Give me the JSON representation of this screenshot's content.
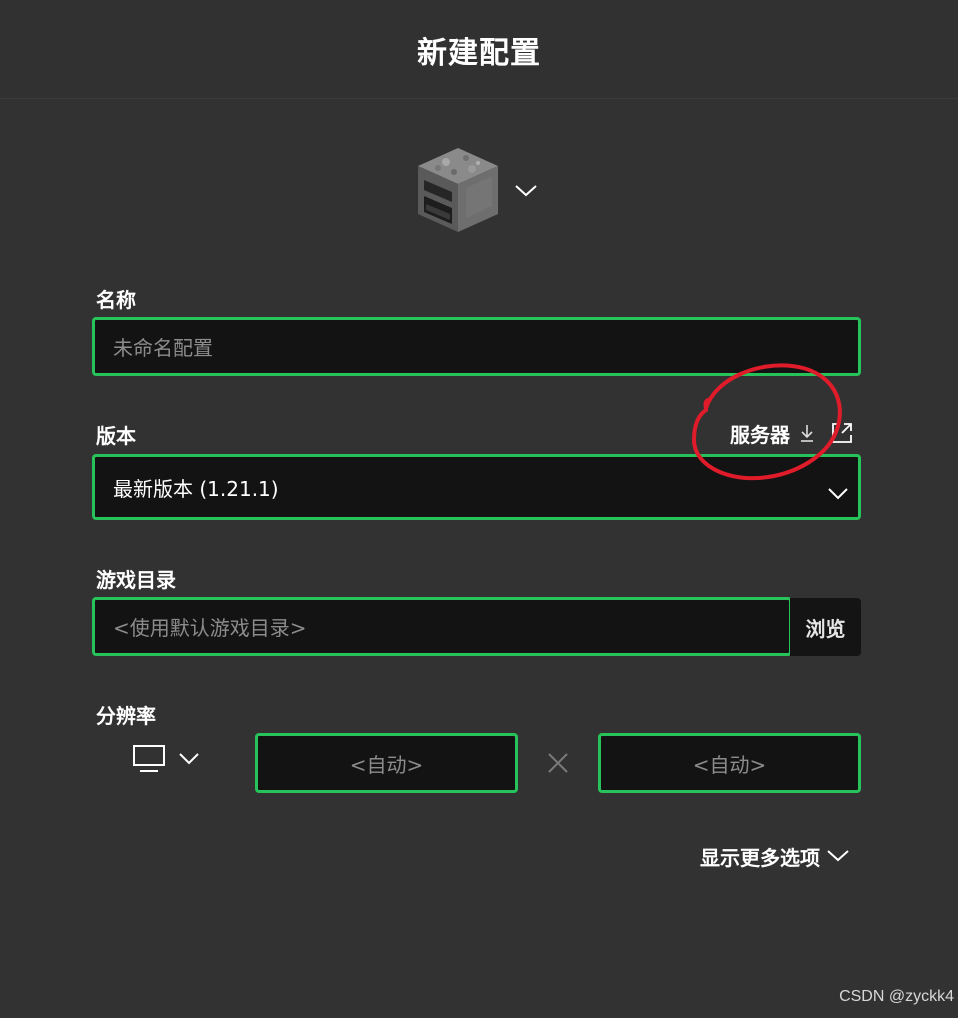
{
  "header": {
    "title": "新建配置"
  },
  "icon_picker": {
    "icon": "furnace-block-icon"
  },
  "name": {
    "label": "名称",
    "placeholder": "未命名配置",
    "value": ""
  },
  "version": {
    "label": "版本",
    "server_label": "服务器",
    "selected": "最新版本 (1.21.1)"
  },
  "game_dir": {
    "label": "游戏目录",
    "placeholder": "<使用默认游戏目录>",
    "browse_label": "浏览"
  },
  "resolution": {
    "label": "分辨率",
    "width_placeholder": "<自动>",
    "height_placeholder": "<自动>"
  },
  "more_options": {
    "label": "显示更多选项"
  },
  "watermark": "CSDN @zyckk4",
  "colors": {
    "background": "#323232",
    "field_bg": "#131313",
    "accent": "#27c35a",
    "annotation": "#e01b2a"
  }
}
